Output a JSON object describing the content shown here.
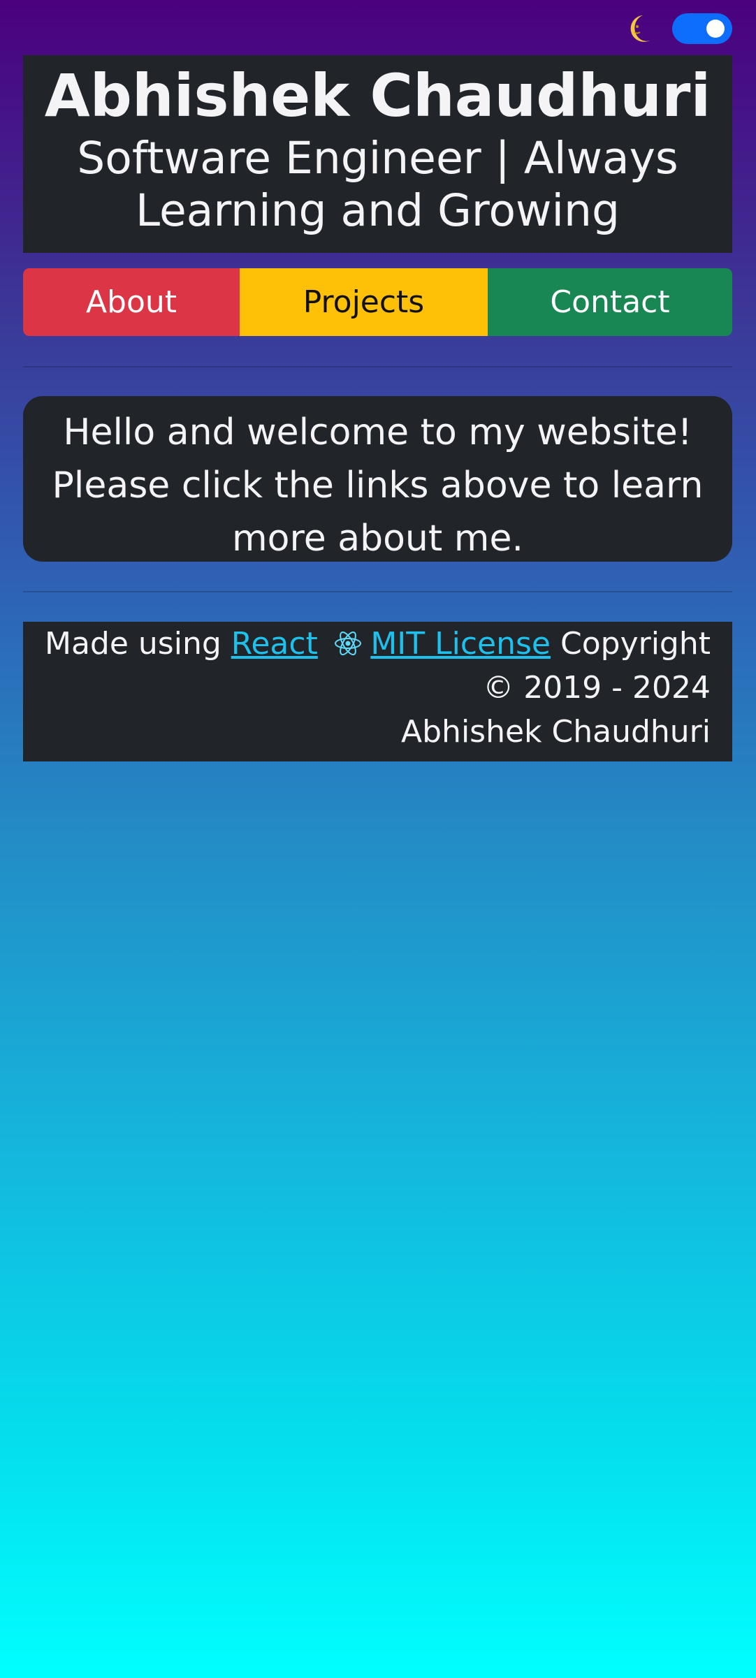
{
  "theme_toggle": {
    "icon": "crescent-moon-icon",
    "accent_color": "#0d6efd",
    "state": "on"
  },
  "header": {
    "name": "Abhishek Chaudhuri",
    "subtitle": "Software Engineer | Always Learning and Growing"
  },
  "nav": {
    "about_label": "About",
    "projects_label": "Projects",
    "contact_label": "Contact",
    "colors": {
      "about": "#dc3545",
      "projects": "#ffc107",
      "contact": "#198754"
    }
  },
  "main": {
    "welcome_text": "Hello and welcome to my website! Please click the links above to learn more about me."
  },
  "footer": {
    "made_using_prefix": "Made using",
    "react_link": "React",
    "react_icon": "react-atom-icon",
    "license_link": "MIT License",
    "copyright_text": "Copyright © 2019 - 2024 Abhishek Chaudhuri"
  }
}
